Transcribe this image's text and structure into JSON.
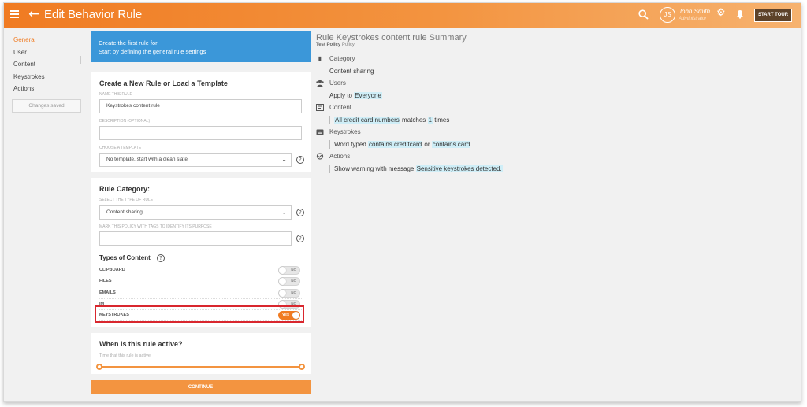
{
  "header": {
    "title": "Edit Behavior Rule",
    "user": {
      "initials": "JS",
      "name": "John Smith",
      "role": "Administrator"
    },
    "start_tour_label": "START TOUR"
  },
  "sidebar": {
    "items": [
      {
        "label": "General",
        "active": true
      },
      {
        "label": "User",
        "active": false
      },
      {
        "label": "Content",
        "active": false
      },
      {
        "label": "Keystrokes",
        "active": false
      },
      {
        "label": "Actions",
        "active": false
      }
    ],
    "status": "Changes saved"
  },
  "banner": {
    "line1": "Create the first rule for",
    "line2": "Start by defining the general rule settings"
  },
  "create_card": {
    "title": "Create a New Rule or Load a Template",
    "name_label": "NAME THIS RULE",
    "name_value": "Keystrokes content rule",
    "description_label": "DESCRIPTION (OPTIONAL)",
    "description_value": "",
    "template_label": "CHOOSE A TEMPLATE",
    "template_value": "No template, start with a clean slate"
  },
  "category_card": {
    "title": "Rule Category:",
    "type_label": "SELECT THE TYPE OF RULE",
    "type_value": "Content sharing",
    "tags_label": "MARK THIS POLICY WITH TAGS TO IDENTIFY ITS PURPOSE",
    "tags_value": "",
    "types_title": "Types of Content",
    "types": [
      {
        "label": "CLIPBOARD",
        "state": "NO",
        "on": false
      },
      {
        "label": "FILES",
        "state": "NO",
        "on": false
      },
      {
        "label": "EMAILS",
        "state": "NO",
        "on": false
      },
      {
        "label": "IM",
        "state": "NO",
        "on": false
      },
      {
        "label": "KEYSTROKES",
        "state": "YES",
        "on": true
      }
    ]
  },
  "active_card": {
    "title": "When is this rule active?",
    "time_label": "Time that this rule is active"
  },
  "continue_label": "CONTINUE",
  "summary": {
    "title": "Rule Keystrokes content rule Summary",
    "sub_bold": "Test Policy",
    "sub_light": "Policy",
    "category": {
      "heading": "Category",
      "value": "Content sharing"
    },
    "users": {
      "heading": "Users",
      "prefix": "Apply to",
      "value": "Everyone"
    },
    "content": {
      "heading": "Content",
      "item": "All credit card numbers",
      "mid": "matches",
      "count": "1",
      "suffix": "times"
    },
    "keystrokes": {
      "heading": "Keystrokes",
      "prefix": "Word typed",
      "cond1": "contains creditcard",
      "mid": "or",
      "cond2": "contains card"
    },
    "actions": {
      "heading": "Actions",
      "prefix": "Show warning with message",
      "message": "Sensitive keystrokes detected."
    }
  },
  "colors": {
    "accent": "#f07b22",
    "banner": "#3b97d9",
    "highlight": "#cfeef7",
    "alert_border": "#d9272e"
  },
  "icons": [
    "menu-icon",
    "back-arrow-icon",
    "search-icon",
    "gear-icon",
    "bell-icon",
    "help-icon",
    "document-icon",
    "users-icon",
    "content-icon",
    "keyboard-icon",
    "check-circle-icon"
  ]
}
